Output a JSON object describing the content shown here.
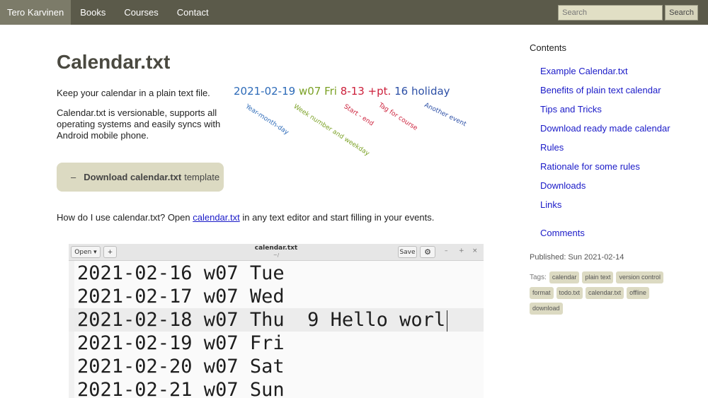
{
  "nav": {
    "brand": "Tero Karvinen",
    "links": [
      "Books",
      "Courses",
      "Contact"
    ],
    "search_placeholder": "Search",
    "search_button": "Search"
  },
  "main": {
    "title": "Calendar.txt",
    "intro1": "Keep your calendar in a plain text file.",
    "intro2": "Calendar.txt is versionable, supports all operating systems and easily syncs with Android mobile phone.",
    "diagram": {
      "date": "2021-02-19",
      "week": "w07 Fri",
      "time": "8-13 +pt.",
      "event": "16 holiday",
      "annotations": [
        "Year-month-day",
        "Week number and weekday",
        "Start - end",
        "Tag for course",
        "Another event"
      ]
    },
    "download": {
      "dash": "–",
      "bold": "Download calendar.txt",
      "rest": "template"
    },
    "usage": {
      "before": "How do I use calendar.txt? Open ",
      "link": "calendar.txt",
      "after": " in any text editor and start filling in your events."
    }
  },
  "editor": {
    "open_label": "Open ▾",
    "new_label": "+",
    "filename": "calendar.txt",
    "subtitle": "~/",
    "save_label": "Save",
    "gear": "⚙",
    "minimize": "–",
    "maximize": "+",
    "close": "×",
    "lines": [
      "2021-02-16 w07 Tue",
      "2021-02-17 w07 Wed",
      "2021-02-18 w07 Thu  9 Hello worl",
      "2021-02-19 w07 Fri",
      "2021-02-20 w07 Sat",
      "2021-02-21 w07 Sun"
    ]
  },
  "sidebar": {
    "contents_heading": "Contents",
    "toc": [
      "Example Calendar.txt",
      "Benefits of plain text calendar",
      "Tips and Tricks",
      "Download ready made calendar",
      "Rules",
      "Rationale for some rules",
      "Downloads",
      "Links",
      "Comments"
    ],
    "published": "Published: Sun 2021-02-14",
    "tags_label": "Tags:",
    "tags": [
      "calendar",
      "plain text",
      "version control",
      "format",
      "todo.txt",
      "calendar.txt",
      "offline",
      "download"
    ]
  },
  "colors": {
    "navbar": "#5b5a4a",
    "brand_bg": "#7c7b69",
    "accent_bg": "#dcdac2",
    "link": "#1a1ac8",
    "date_color": "#2c6ab8",
    "week_color": "#7ba125",
    "time_color": "#cc1f3a",
    "holiday_color": "#2c4fa6"
  }
}
